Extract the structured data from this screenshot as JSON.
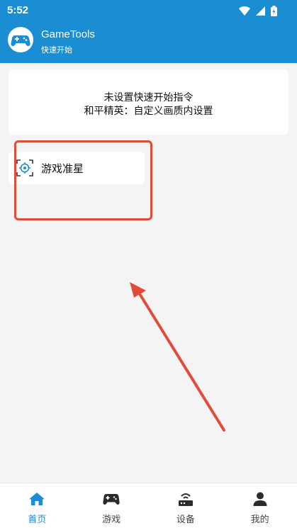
{
  "status_bar": {
    "time": "5:52"
  },
  "app_bar": {
    "title": "GameTools",
    "subtitle": "快速开始"
  },
  "info_card": {
    "line1": "未设置快速开始指令",
    "line2": "和平精英：自定义画质内设置"
  },
  "features": [
    {
      "label": "游戏准星",
      "icon": "crosshair-icon"
    }
  ],
  "bottom_nav": [
    {
      "label": "首页",
      "icon": "home-icon",
      "active": true
    },
    {
      "label": "游戏",
      "icon": "gamepad-icon",
      "active": false
    },
    {
      "label": "设备",
      "icon": "router-icon",
      "active": false
    },
    {
      "label": "我的",
      "icon": "person-icon",
      "active": false
    }
  ],
  "colors": {
    "primary": "#1a8dd3",
    "annotation": "#e04b3a",
    "background": "#f4f4f4"
  }
}
